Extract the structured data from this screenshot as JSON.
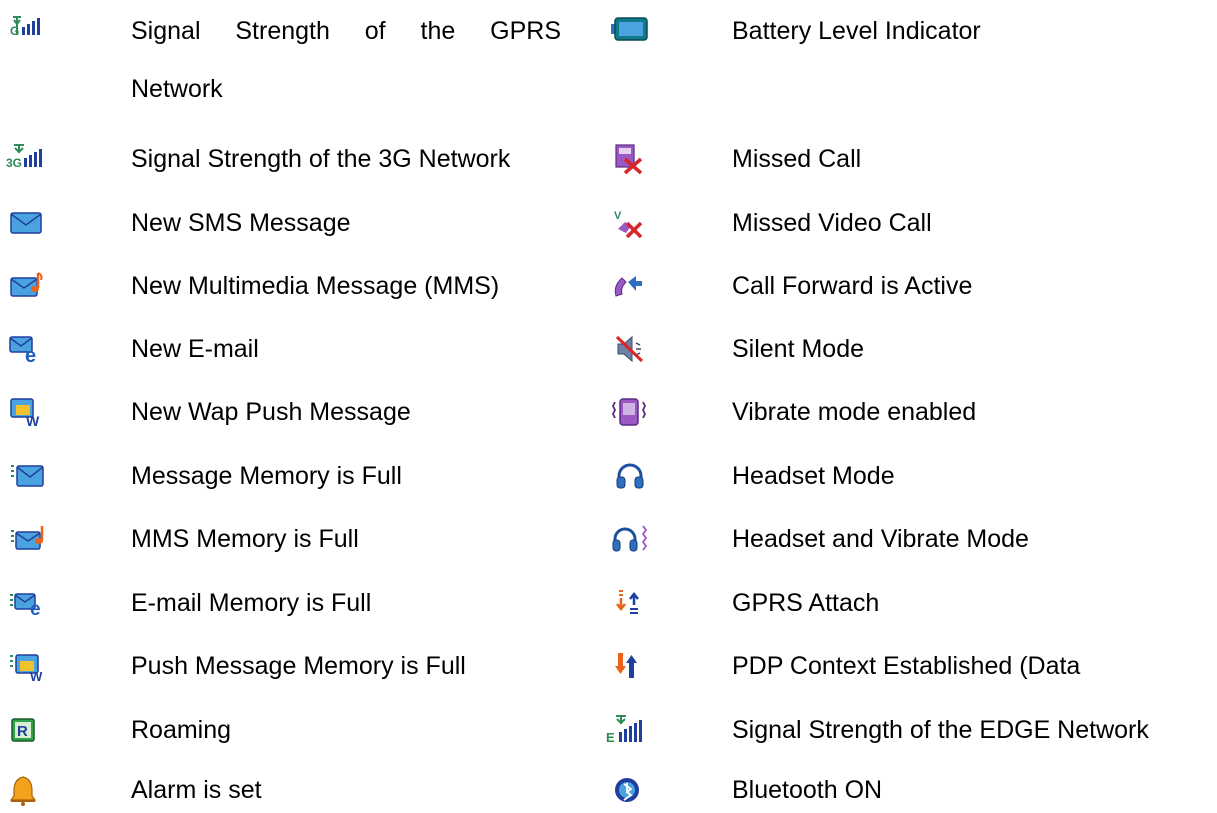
{
  "left_column": [
    {
      "icon": "gprs-signal-icon",
      "label": "Signal Strength of the GPRS",
      "label_cont": "Network"
    },
    {
      "icon": "3g-signal-icon",
      "label": "Signal Strength of the 3G Network"
    },
    {
      "icon": "sms-envelope-icon",
      "label": "New SMS Message"
    },
    {
      "icon": "mms-envelope-icon",
      "label": "New Multimedia Message (MMS)"
    },
    {
      "icon": "email-envelope-icon",
      "label": "New E-mail"
    },
    {
      "icon": "wap-push-icon",
      "label": "New Wap Push Message"
    },
    {
      "icon": "message-memory-full-icon",
      "label": "Message Memory is Full"
    },
    {
      "icon": "mms-memory-full-icon",
      "label": "MMS Memory is Full"
    },
    {
      "icon": "email-memory-full-icon",
      "label": "E-mail Memory is Full"
    },
    {
      "icon": "push-memory-full-icon",
      "label": "Push Message Memory is Full"
    },
    {
      "icon": "roaming-icon",
      "label": "Roaming"
    },
    {
      "icon": "alarm-bell-icon",
      "label": "Alarm is set"
    }
  ],
  "right_column": [
    {
      "icon": "battery-icon",
      "label": "Battery Level Indicator"
    },
    {
      "icon": "missed-call-icon",
      "label": "Missed Call"
    },
    {
      "icon": "missed-video-call-icon",
      "label": "Missed Video Call"
    },
    {
      "icon": "call-forward-icon",
      "label": "Call Forward is Active"
    },
    {
      "icon": "silent-mode-icon",
      "label": "Silent Mode"
    },
    {
      "icon": "vibrate-icon",
      "label": "Vibrate mode enabled"
    },
    {
      "icon": "headset-icon",
      "label": "Headset Mode"
    },
    {
      "icon": "headset-vibrate-icon",
      "label": "Headset and Vibrate Mode"
    },
    {
      "icon": "gprs-attach-icon",
      "label": "GPRS Attach"
    },
    {
      "icon": "pdp-context-icon",
      "label": "PDP Context Established (Data"
    },
    {
      "icon": "edge-signal-icon",
      "label": "Signal Strength of the EDGE Network"
    },
    {
      "icon": "bluetooth-icon",
      "label": "Bluetooth ON"
    }
  ],
  "colors": {
    "signal_green": "#2e8b57",
    "signal_blue": "#1f3f9f",
    "envelope_blue": "#4aa3df",
    "alert_red": "#d8262b",
    "roaming_green": "#2fa24a",
    "bell_orange": "#f2a21c",
    "arrow_orange": "#e9631a"
  }
}
